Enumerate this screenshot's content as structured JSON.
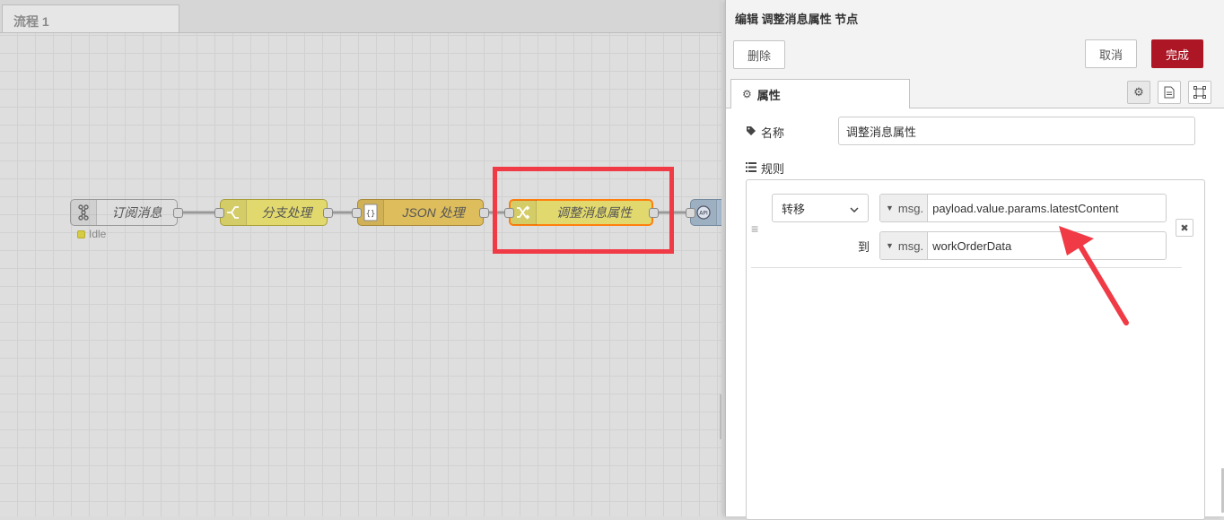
{
  "workspace": {
    "tab_label": "流程 1",
    "nodes": [
      {
        "label": "订阅消息",
        "icon": "subscribe-icon",
        "color": "#c7c7c7"
      },
      {
        "label": "分支处理",
        "icon": "switch-icon",
        "color": "#e2d96e"
      },
      {
        "label": "JSON 处理",
        "icon": "json-icon",
        "color": "#debd5c"
      },
      {
        "label": "调整消息属性",
        "icon": "change-icon",
        "color": "#e2d96e"
      },
      {
        "label": "",
        "icon": "api-icon",
        "color": "#a6bbcf"
      }
    ],
    "status_text": "Idle",
    "status_color": "#d6cc43",
    "highlight_color": "#f03a45"
  },
  "tray": {
    "title": "编辑 调整消息属性 节点",
    "delete_label": "删除",
    "cancel_label": "取消",
    "done_label": "完成",
    "done_color": "#ad1625",
    "properties_tab": "属性",
    "name_label": "名称",
    "name_value": "调整消息属性",
    "rules_label": "规则",
    "rule": {
      "action": "转移",
      "from_type": "msg.",
      "from_value": "payload.value.params.latestContent",
      "to_label": "到",
      "to_type": "msg.",
      "to_value": "workOrderData"
    }
  }
}
